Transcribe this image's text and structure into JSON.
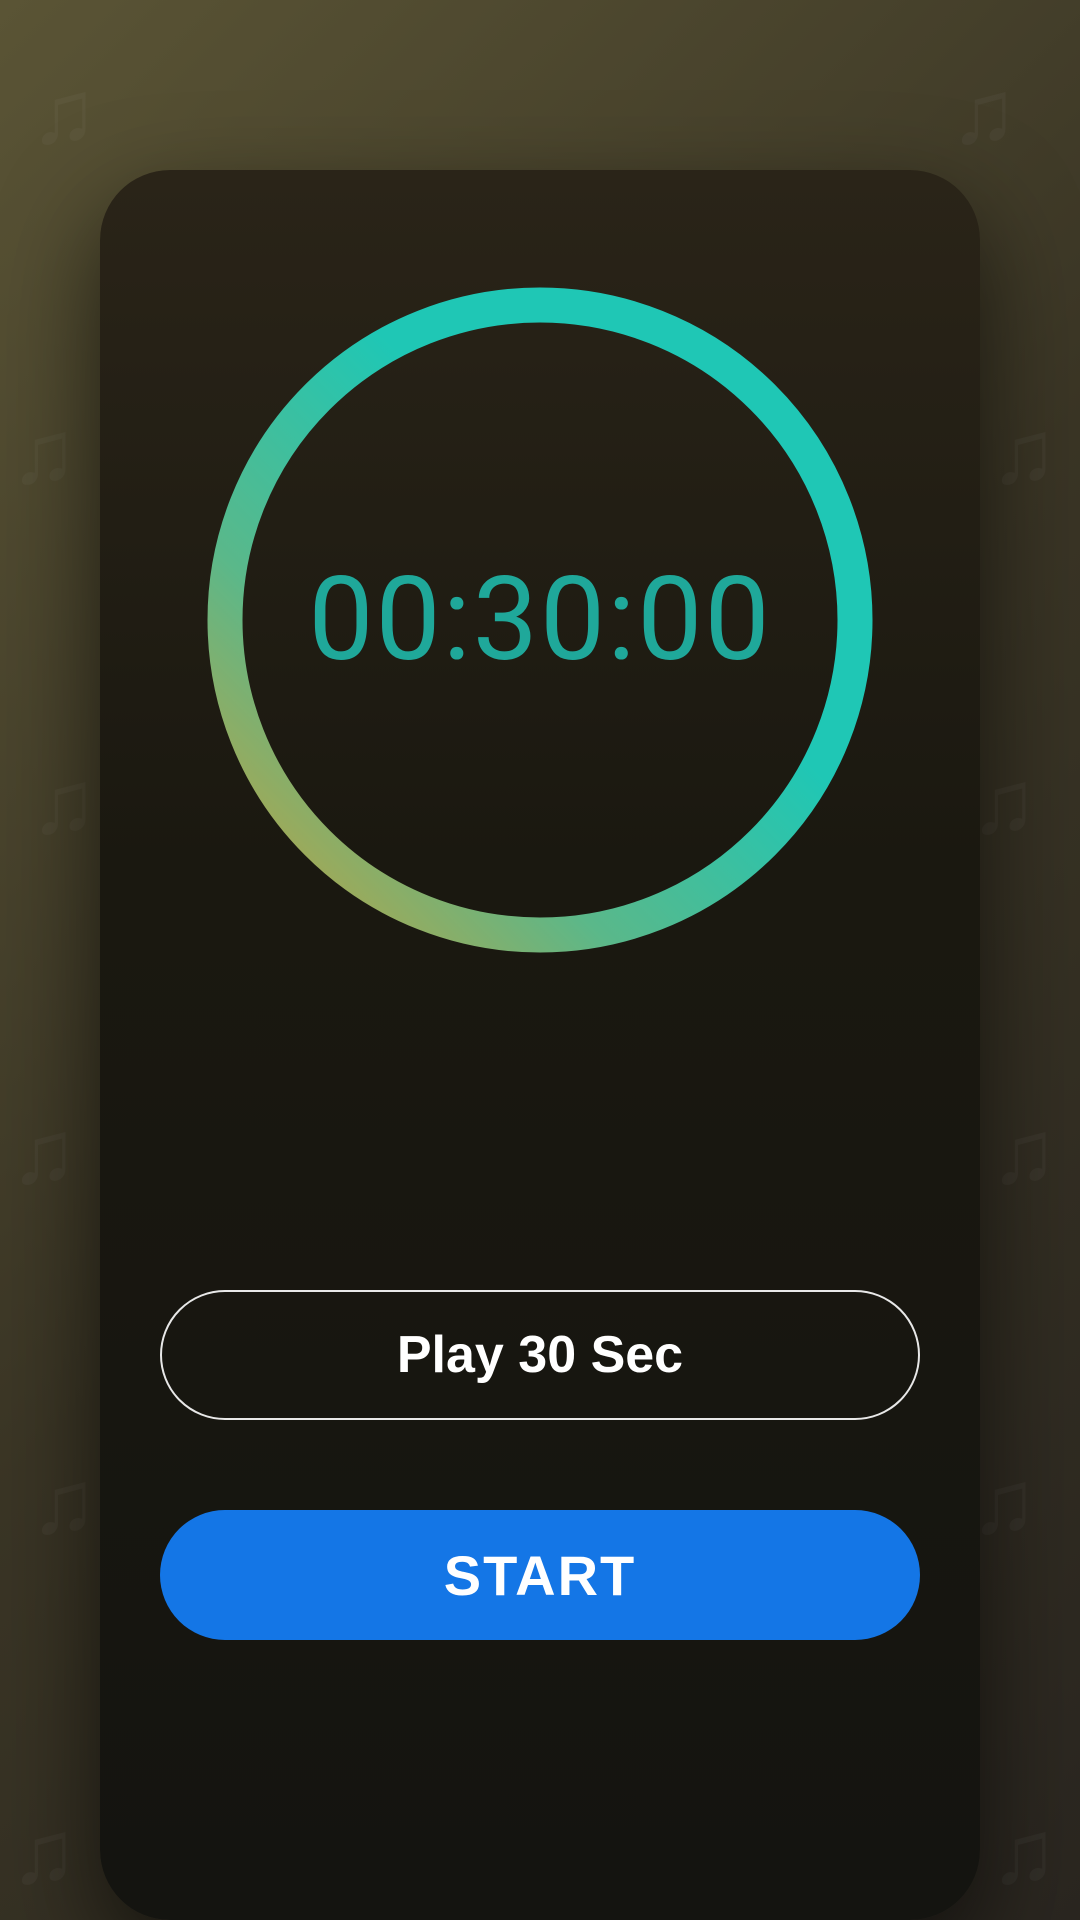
{
  "timer": {
    "display": "00:30:00"
  },
  "buttons": {
    "play_label": "Play 30 Sec",
    "start_label": "START"
  },
  "colors": {
    "accent_primary": "#1476e6",
    "ring_gradient_start": "#c9a03a",
    "ring_gradient_end": "#1fc7b5",
    "timer_text": "#1fa89a"
  }
}
